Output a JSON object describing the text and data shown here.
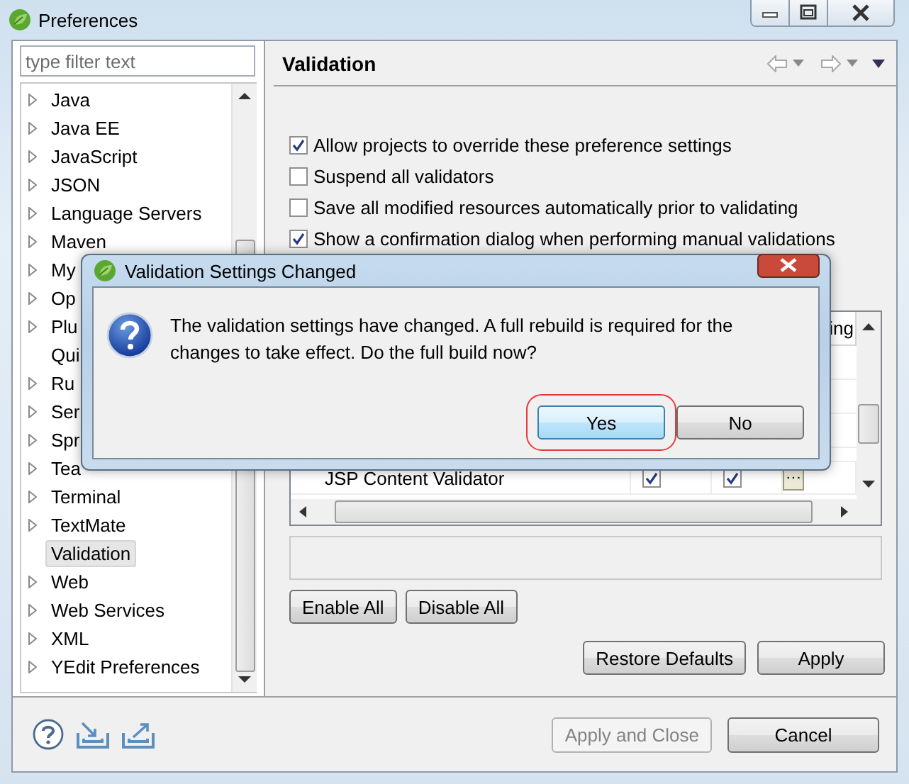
{
  "window": {
    "title": "Preferences"
  },
  "filter": {
    "placeholder": "type filter text"
  },
  "tree": [
    {
      "label": "Java",
      "expandable": true,
      "selected": false
    },
    {
      "label": "Java EE",
      "expandable": true,
      "selected": false
    },
    {
      "label": "JavaScript",
      "expandable": true,
      "selected": false
    },
    {
      "label": "JSON",
      "expandable": true,
      "selected": false
    },
    {
      "label": "Language Servers",
      "expandable": true,
      "selected": false
    },
    {
      "label": "Maven",
      "expandable": true,
      "selected": false
    },
    {
      "label": "My",
      "expandable": true,
      "selected": false
    },
    {
      "label": "Op",
      "expandable": true,
      "selected": false
    },
    {
      "label": "Plu",
      "expandable": true,
      "selected": false
    },
    {
      "label": "Qui",
      "expandable": false,
      "selected": false
    },
    {
      "label": "Ru",
      "expandable": true,
      "selected": false
    },
    {
      "label": "Ser",
      "expandable": true,
      "selected": false
    },
    {
      "label": "Spr",
      "expandable": true,
      "selected": false
    },
    {
      "label": "Tea",
      "expandable": true,
      "selected": false
    },
    {
      "label": "Terminal",
      "expandable": true,
      "selected": false
    },
    {
      "label": "TextMate",
      "expandable": true,
      "selected": false
    },
    {
      "label": "Validation",
      "expandable": false,
      "selected": true
    },
    {
      "label": "Web",
      "expandable": true,
      "selected": false
    },
    {
      "label": "Web Services",
      "expandable": true,
      "selected": false
    },
    {
      "label": "XML",
      "expandable": true,
      "selected": false
    },
    {
      "label": "YEdit Preferences",
      "expandable": true,
      "selected": false
    }
  ],
  "page": {
    "title": "Validation",
    "options": [
      {
        "label": "Allow projects to override these preference settings",
        "checked": true
      },
      {
        "label": "Suspend all validators",
        "checked": false
      },
      {
        "label": "Save all modified resources automatically prior to validating",
        "checked": false
      },
      {
        "label": "Show a confirmation dialog when performing manual validations",
        "checked": true
      }
    ],
    "table": {
      "column_4": "ing",
      "rows": [
        {
          "name": "JSP Content Validator",
          "column_2": true,
          "column_3": true,
          "settings": "···"
        }
      ]
    },
    "list_buttons": [
      "Enable All",
      "Disable All"
    ],
    "page_buttons": [
      "Restore Defaults",
      "Apply"
    ]
  },
  "bottom": {
    "buttons": [
      {
        "label": "Apply and Close",
        "disabled": true
      },
      {
        "label": "Cancel",
        "disabled": false
      }
    ]
  },
  "dialog": {
    "title": "Validation Settings Changed",
    "message": "The validation settings have changed. A full rebuild is required for the changes to take effect. Do the full build now?",
    "buttons": [
      {
        "label": "Yes",
        "focused": true,
        "highlighted": true
      },
      {
        "label": "No",
        "focused": false,
        "highlighted": false
      }
    ]
  }
}
